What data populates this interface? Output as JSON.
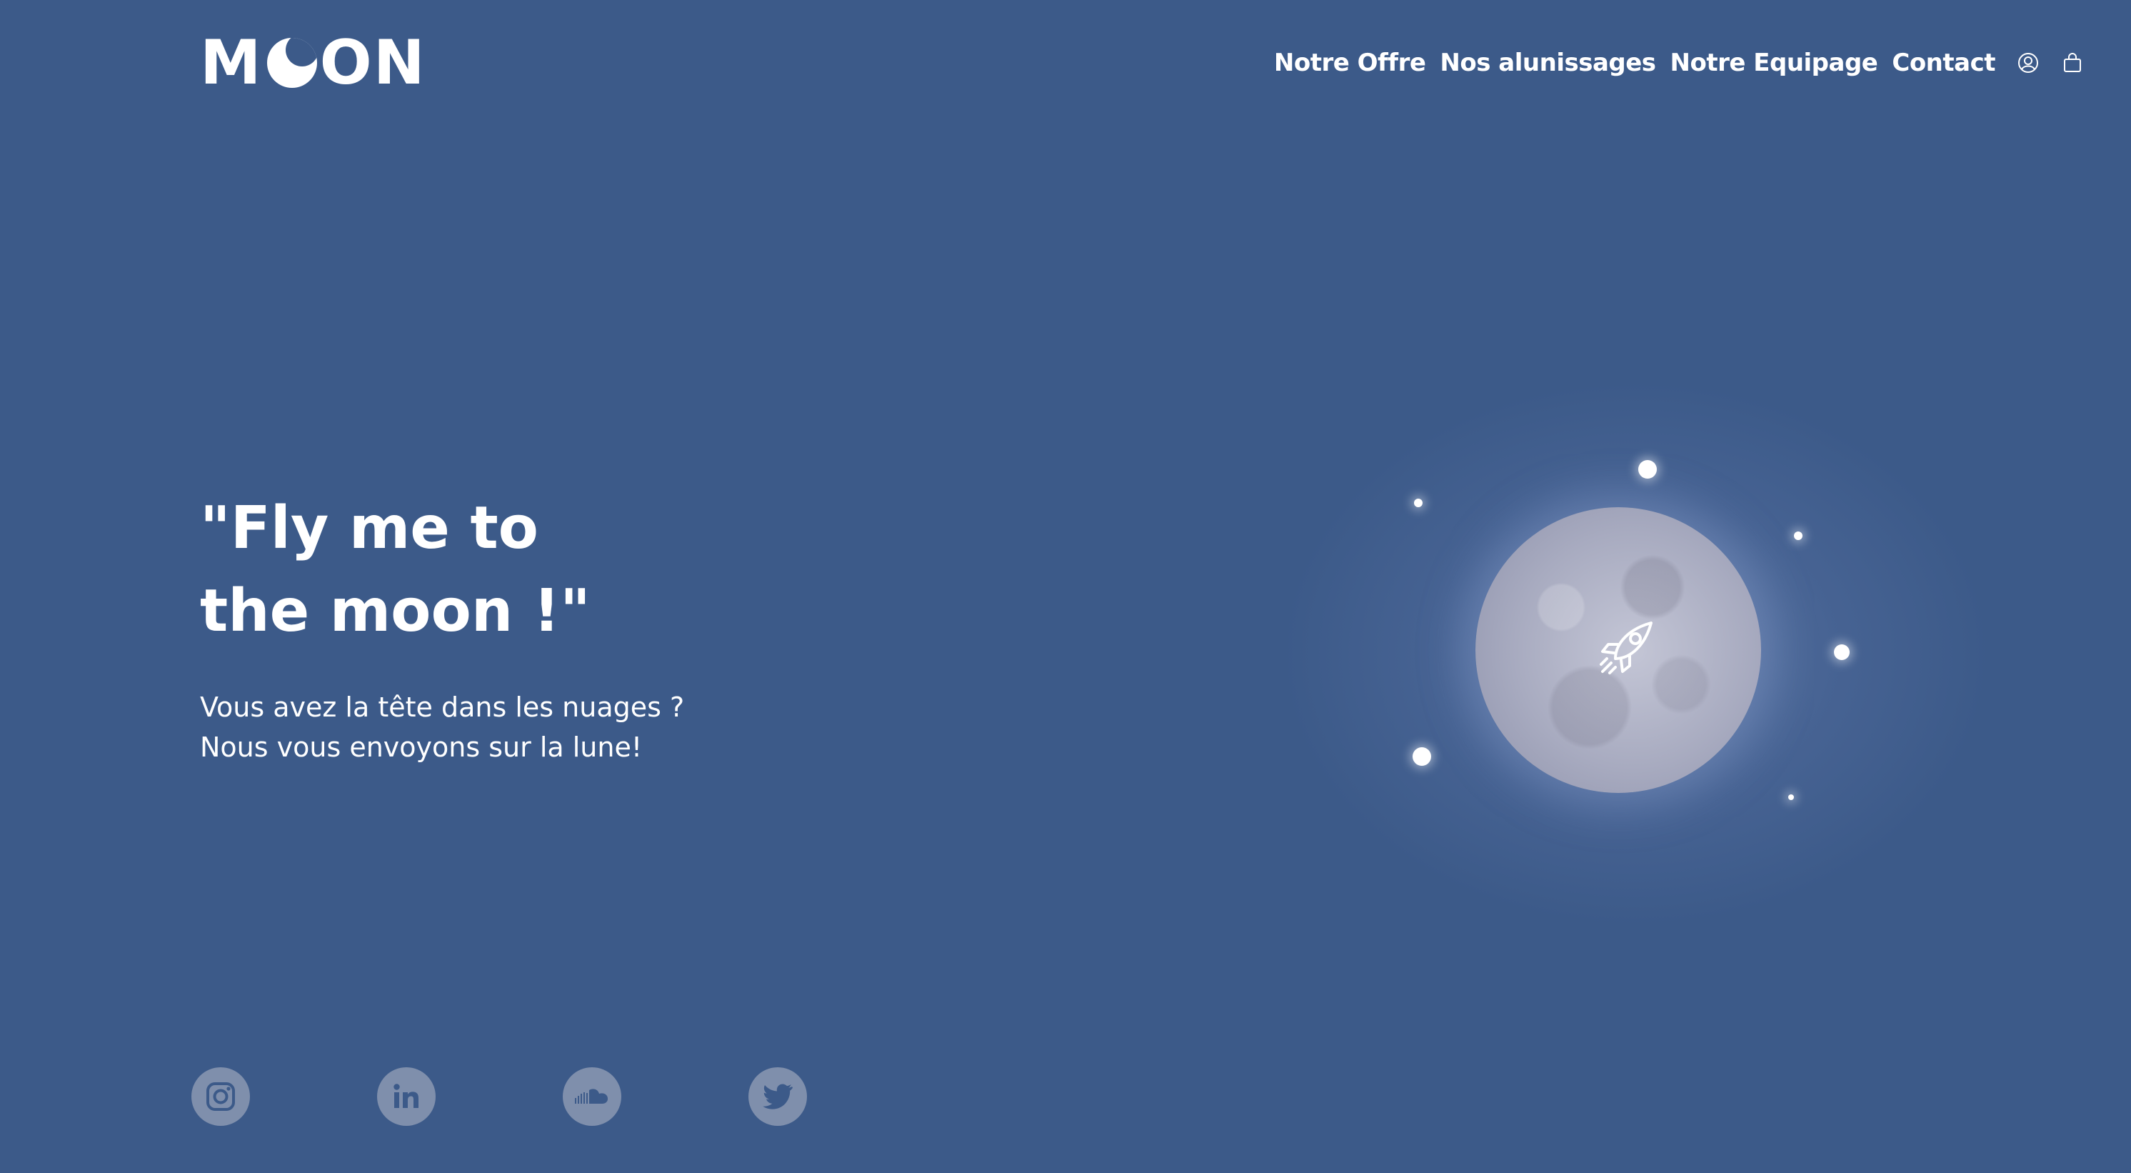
{
  "brand": {
    "logo_text_left": "M",
    "logo_text_right": "ON",
    "logo_full": "MOON"
  },
  "nav": {
    "links": [
      {
        "label": "Notre Offre"
      },
      {
        "label": "Nos alunissages"
      },
      {
        "label": "Notre Equipage"
      },
      {
        "label": "Contact"
      }
    ],
    "icons": [
      "user-icon",
      "bag-icon"
    ]
  },
  "hero": {
    "title_line1": "\"Fly me to",
    "title_line2": "the moon !\"",
    "subtitle_line1": "Vous avez la tête dans les nuages ?",
    "subtitle_line2": "Nous vous envoyons sur la lune!"
  },
  "illustration": {
    "center_icon": "rocket-icon"
  },
  "socials": [
    {
      "icon": "instagram-icon"
    },
    {
      "icon": "linkedin-icon"
    },
    {
      "icon": "soundcloud-icon"
    },
    {
      "icon": "twitter-icon"
    }
  ],
  "colors": {
    "background": "#3c5a89",
    "text": "#ffffff",
    "social_bg": "#7f8fac",
    "social_icon": "#3c5a89"
  }
}
